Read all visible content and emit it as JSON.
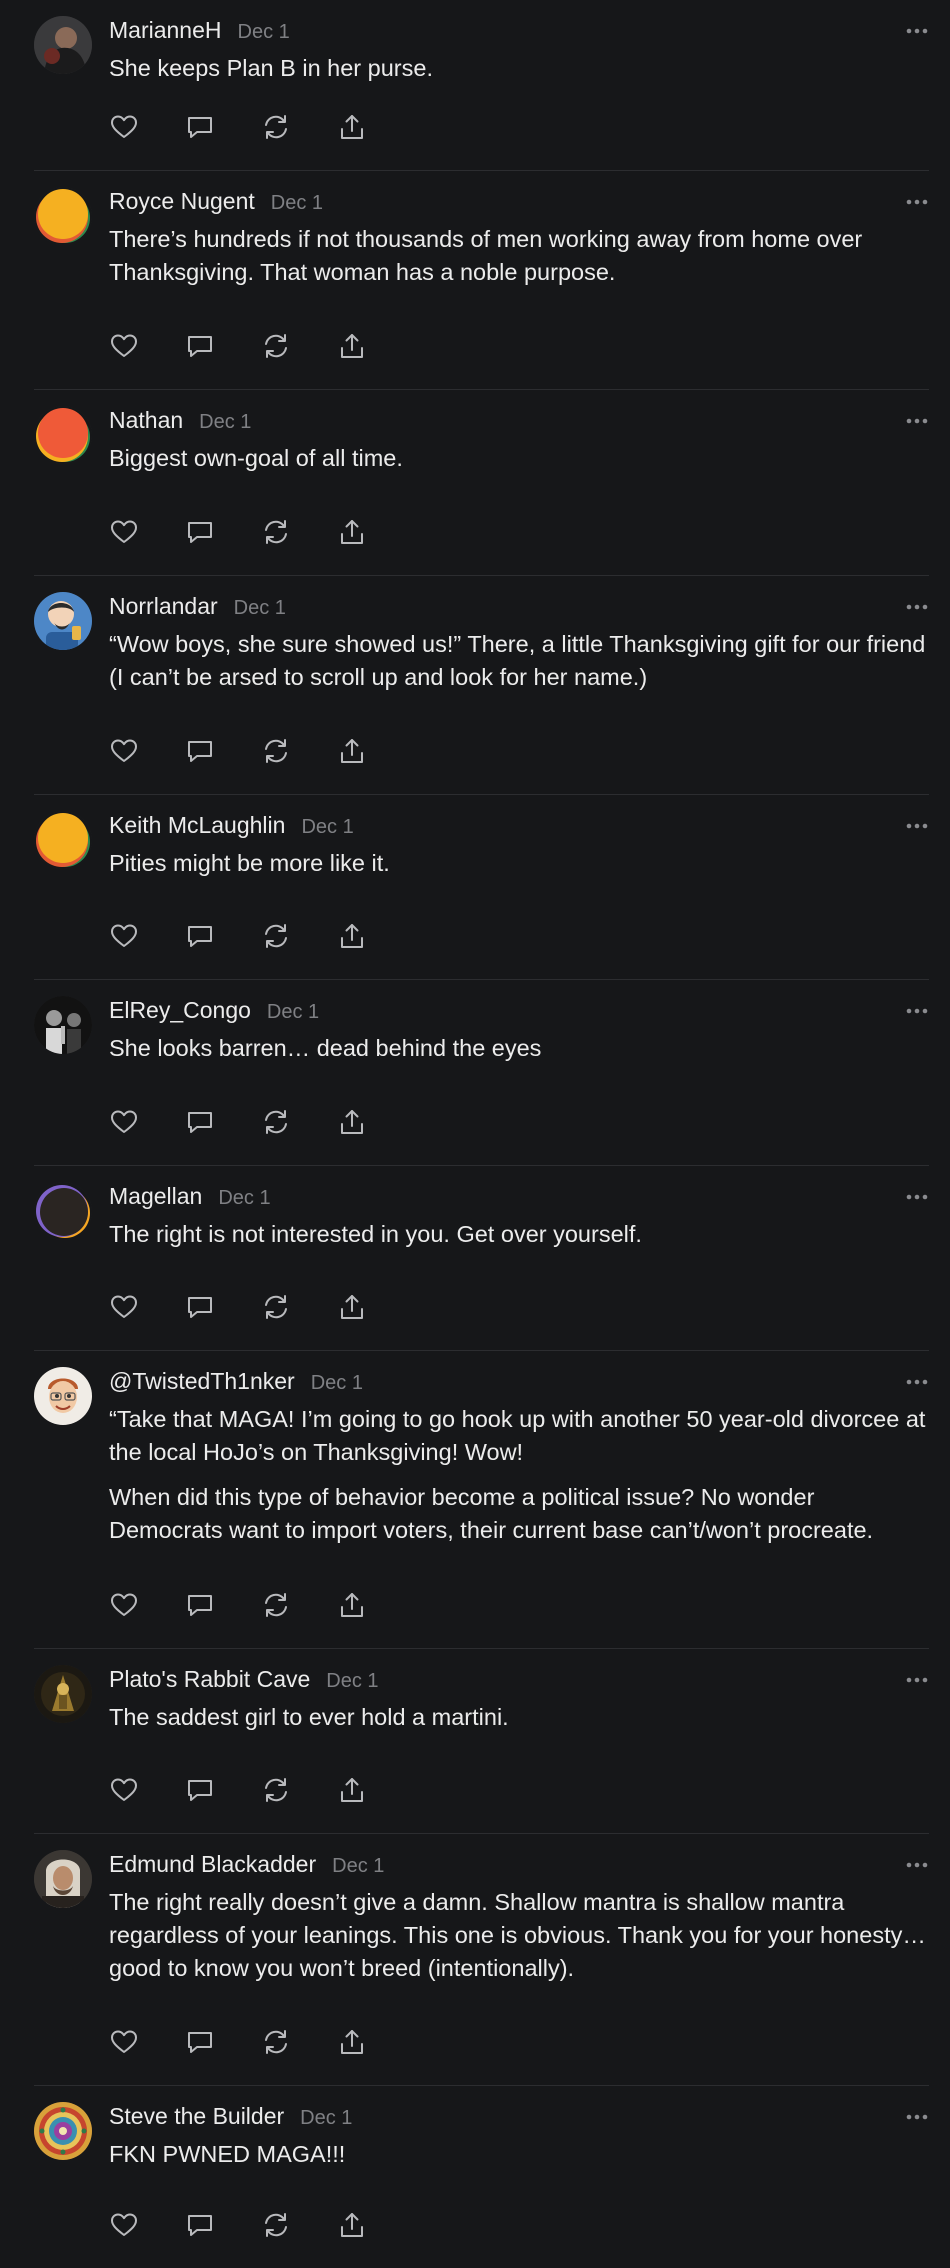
{
  "comments": [
    {
      "author": "MarianneH",
      "date": "Dec 1",
      "avatar": "photo-avatar-dark",
      "paragraphs": [
        "She keeps Plan B in her purse."
      ]
    },
    {
      "author": "Royce Nugent",
      "date": "Dec 1",
      "avatar": "default-avatar-yellow",
      "paragraphs": [
        "There’s hundreds if not thousands of men working away from home over Thanksgiving. That woman has a noble purpose."
      ]
    },
    {
      "author": "Nathan",
      "date": "Dec 1",
      "avatar": "default-avatar-orange",
      "paragraphs": [
        "Biggest own-goal of all time."
      ]
    },
    {
      "author": "Norrlandar",
      "date": "Dec 1",
      "avatar": "cartoon-avatar-blue",
      "paragraphs": [
        "“Wow boys, she sure showed us!” There, a little Thanksgiving gift for our friend (I can’t be arsed to scroll up and look for her name.)"
      ]
    },
    {
      "author": "Keith McLaughlin",
      "date": "Dec 1",
      "avatar": "default-avatar-yellow",
      "paragraphs": [
        "Pities might be more like it."
      ]
    },
    {
      "author": "ElRey_Congo",
      "date": "Dec 1",
      "avatar": "photo-avatar-bw",
      "paragraphs": [
        "She looks barren… dead behind the eyes"
      ]
    },
    {
      "author": "Magellan",
      "date": "Dec 1",
      "avatar": "default-avatar-dark",
      "paragraphs": [
        "The right is not interested in you. Get over yourself."
      ]
    },
    {
      "author": "@TwistedTh1nker",
      "date": "Dec 1",
      "avatar": "cartoon-avatar-face",
      "paragraphs": [
        "“Take that MAGA! I’m going to go hook up with another 50 year-old divorcee at the local HoJo’s on Thanksgiving! Wow!",
        "When did this type of behavior become a political issue? No wonder Democrats want to import voters, their current base can’t/won’t procreate."
      ]
    },
    {
      "author": "Plato's Rabbit Cave",
      "date": "Dec 1",
      "avatar": "photo-avatar-gold",
      "paragraphs": [
        "The saddest girl to ever hold a martini."
      ]
    },
    {
      "author": "Edmund Blackadder",
      "date": "Dec 1",
      "avatar": "photo-avatar-portrait",
      "paragraphs": [
        "The right really doesn’t give a damn. Shallow mantra is shallow mantra regardless of your leanings. This one is obvious. Thank you for your honesty…good to know you won’t breed (intentionally)."
      ]
    },
    {
      "author": "Steve the Builder",
      "date": "Dec 1",
      "avatar": "mandala-avatar",
      "paragraphs": [
        "FKN PWNED MAGA!!!"
      ]
    }
  ],
  "actions": [
    {
      "name": "like",
      "icon": "heart-icon"
    },
    {
      "name": "reply",
      "icon": "comment-icon"
    },
    {
      "name": "restack",
      "icon": "restack-icon"
    },
    {
      "name": "share",
      "icon": "share-icon"
    }
  ],
  "colors": {
    "background": "#161719",
    "text": "#ececec",
    "muted": "#7f8084",
    "divider": "#2c2d30"
  }
}
